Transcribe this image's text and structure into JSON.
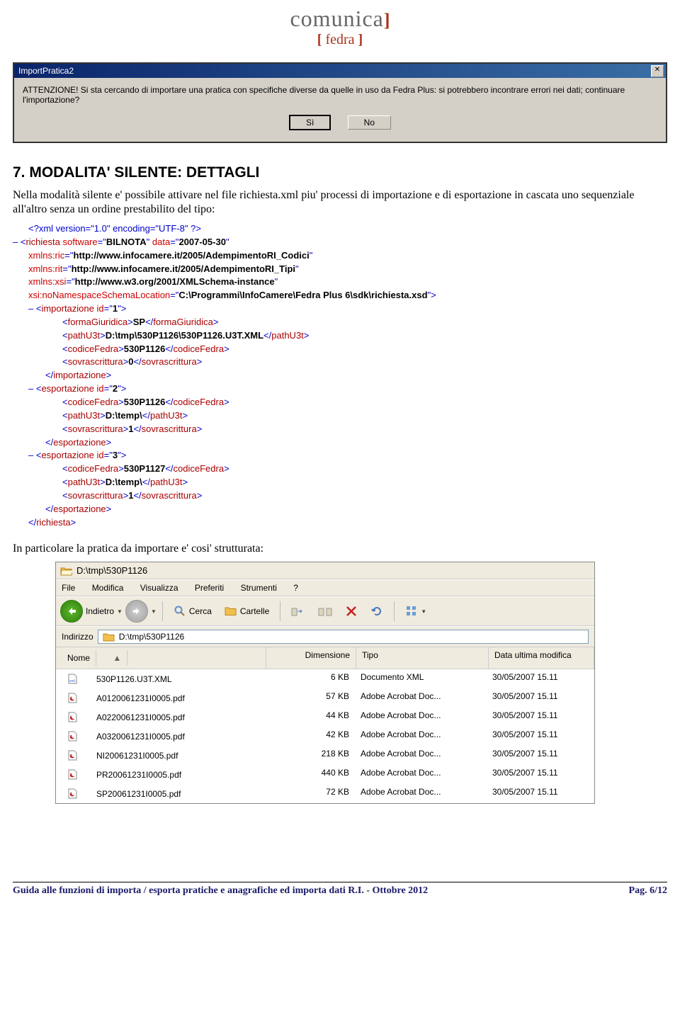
{
  "logo": {
    "main": "comunica",
    "sub": "fedra"
  },
  "dialog": {
    "title": "ImportPratica2",
    "text": "ATTENZIONE! Si sta cercando di importare una pratica con specifiche diverse da quelle in uso da Fedra Plus: si potrebbero incontrare errori nei dati; continuare l'importazione?",
    "yes": "Sì",
    "no": "No"
  },
  "heading": "7.  MODALITA'  SILENTE: DETTAGLI",
  "para1": "Nella modalità silente e' possibile attivare nel file richiesta.xml piu' processi di importazione e di esportazione in cascata uno sequenziale all'altro senza un ordine prestabilito del tipo:",
  "xml": {
    "declaration": "<?xml version=\"1.0\" encoding=\"UTF-8\" ?>",
    "richiesta_software": "BILNOTA",
    "richiesta_data": "2007-05-30",
    "ns_ric": "http://www.infocamere.it/2005/AdempimentoRI_Codici",
    "ns_rit": "http://www.infocamere.it/2005/AdempimentoRI_Tipi",
    "ns_xsi": "http://www.w3.org/2001/XMLSchema-instance",
    "xsi_loc": "C:\\Programmi\\InfoCamere\\Fedra Plus 6\\sdk\\richiesta.xsd",
    "imp_id": "1",
    "formaGiuridica": "SP",
    "imp_pathU3t": "D:\\tmp\\530P1126\\530P1126.U3T.XML",
    "imp_codice": "530P1126",
    "imp_sovra": "0",
    "esp1_id": "2",
    "esp1_codice": "530P1126",
    "esp1_path": "D:\\temp\\",
    "esp1_sovra": "1",
    "esp2_id": "3",
    "esp2_codice": "530P1127",
    "esp2_path": "D:\\temp\\",
    "esp2_sovra": "1"
  },
  "para2": "In particolare la pratica da importare e' cosi' strutturata:",
  "explorer": {
    "title": "D:\\tmp\\530P1126",
    "menu": [
      "File",
      "Modifica",
      "Visualizza",
      "Preferiti",
      "Strumenti",
      "?"
    ],
    "toolbar": {
      "back": "Indietro",
      "search": "Cerca",
      "folders": "Cartelle"
    },
    "addr_label": "Indirizzo",
    "addr_value": "D:\\tmp\\530P1126",
    "cols": {
      "nome": "Nome",
      "dim": "Dimensione",
      "tipo": "Tipo",
      "data": "Data ultima modifica"
    },
    "rows": [
      {
        "icon": "xml",
        "name": "530P1126.U3T.XML",
        "size": "6 KB",
        "type": "Documento XML",
        "date": "30/05/2007 15.11"
      },
      {
        "icon": "pdf",
        "name": "A0120061231I0005.pdf",
        "size": "57 KB",
        "type": "Adobe Acrobat Doc...",
        "date": "30/05/2007 15.11"
      },
      {
        "icon": "pdf",
        "name": "A0220061231I0005.pdf",
        "size": "44 KB",
        "type": "Adobe Acrobat Doc...",
        "date": "30/05/2007 15.11"
      },
      {
        "icon": "pdf",
        "name": "A0320061231I0005.pdf",
        "size": "42 KB",
        "type": "Adobe Acrobat Doc...",
        "date": "30/05/2007 15.11"
      },
      {
        "icon": "pdf",
        "name": "NI20061231I0005.pdf",
        "size": "218 KB",
        "type": "Adobe Acrobat Doc...",
        "date": "30/05/2007 15.11"
      },
      {
        "icon": "pdf",
        "name": "PR20061231I0005.pdf",
        "size": "440 KB",
        "type": "Adobe Acrobat Doc...",
        "date": "30/05/2007 15.11"
      },
      {
        "icon": "pdf",
        "name": "SP20061231I0005.pdf",
        "size": "72 KB",
        "type": "Adobe Acrobat Doc...",
        "date": "30/05/2007 15.11"
      }
    ]
  },
  "footer": {
    "left": "Guida alle funzioni di importa / esporta pratiche e anagrafiche ed importa dati R.I. - Ottobre 2012",
    "right": "Pag. 6/12"
  }
}
